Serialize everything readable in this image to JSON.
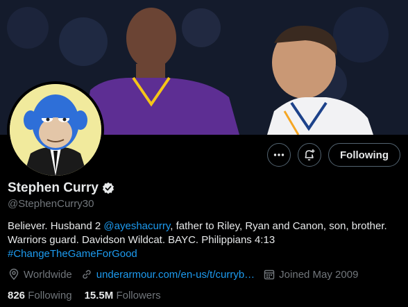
{
  "profile": {
    "name": "Stephen Curry",
    "handle": "@StephenCurry30",
    "bio": {
      "part1": "Believer. Husband 2 ",
      "mention": "@ayeshacurry",
      "part2": ", father to Riley, Ryan and Canon, son, brother. Warriors guard. Davidson Wildcat. BAYC. Philippians 4:13",
      "hashtag": "#ChangeTheGameForGood"
    },
    "location": "Worldwide",
    "website": "underarmour.com/en-us/t/curryb…",
    "joined": "Joined May 2009",
    "following_count": "826",
    "following_label": "Following",
    "followers_count": "15.5M",
    "followers_label": "Followers"
  },
  "actions": {
    "more_icon": "more-horizontal-icon",
    "notify_icon": "bell-plus-icon",
    "follow_label": "Following"
  },
  "colors": {
    "background": "#000000",
    "text": "#e7e9ea",
    "secondary": "#71767b",
    "accent": "#1d9bf0",
    "border": "#536471"
  }
}
